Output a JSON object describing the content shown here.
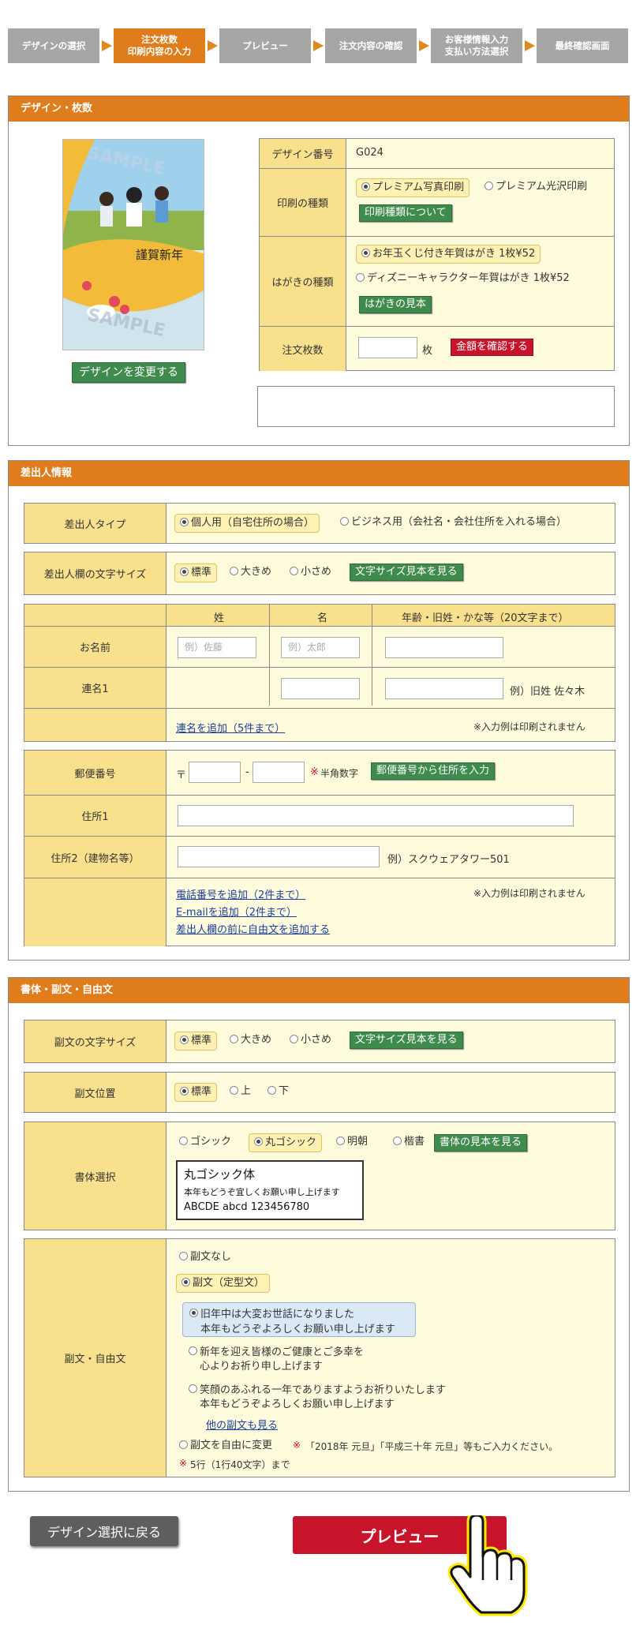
{
  "steps": [
    "デザインの選択",
    "注文枚数\n印刷内容の入力",
    "プレビュー",
    "注文内容の確認",
    "お客様情報入力\n支払い方法選択",
    "最終確認画面"
  ],
  "s1": {
    "title": "デザイン・枚数",
    "thumb_text": "謹賀新年",
    "watermark": "SAMPLE",
    "change_btn": "デザインを変更する",
    "design_label": "デザイン番号",
    "design_value": "G024",
    "print_label": "印刷の種類",
    "print_opt1": "プレミアム写真印刷",
    "print_opt2": "プレミアム光沢印刷",
    "print_btn": "印刷種類について",
    "card_label": "はがきの種類",
    "card_opt1": "お年玉くじ付き年賀はがき 1枚¥52",
    "card_opt2": "ディズニーキャラクター年賀はがき 1枚¥52",
    "card_btn": "はがきの見本",
    "qty_label": "注文枚数",
    "qty_unit": "枚",
    "qty_btn": "金額を確認する"
  },
  "s2": {
    "title": "差出人情報",
    "type_label": "差出人タイプ",
    "type_opt1": "個人用（自宅住所の場合）",
    "type_opt2": "ビジネス用（会社名・会社住所を入れる場合）",
    "size_label": "差出人欄の文字サイズ",
    "size_opt1": "標準",
    "size_opt2": "大きめ",
    "size_opt3": "小さめ",
    "size_btn": "文字サイズ見本を見る",
    "col_sei": "姓",
    "col_mei": "名",
    "col_extra": "年齢・旧姓・かな等（20文字まで）",
    "name_label": "お名前",
    "sei_ph": "例）佐藤",
    "mei_ph": "例）太郎",
    "renmei_label": "連名1",
    "renmei_hint": "例）旧姓 佐々木",
    "add_renmei": "連名を追加（5件まで）",
    "note1": "※入力例は印刷されません",
    "zip_label": "郵便番号",
    "zip_mark": "〒",
    "zip_dash": "-",
    "zip_note_mark": "※",
    "zip_note": "半角数字",
    "zip_btn": "郵便番号から住所を入力",
    "addr1_label": "住所1",
    "addr2_label": "住所2（建物名等）",
    "addr2_hint": "例）スクウェアタワー501",
    "add_tel": "電話番号を追加（2件まで）",
    "add_email": "E-mailを追加（2件まで）",
    "add_free": "差出人欄の前に自由文を追加する",
    "note2": "※入力例は印刷されません"
  },
  "s3": {
    "title": "書体・副文・自由文",
    "size_label": "副文の文字サイズ",
    "size_opt1": "標準",
    "size_opt2": "大きめ",
    "size_opt3": "小さめ",
    "size_btn": "文字サイズ見本を見る",
    "pos_label": "副文位置",
    "pos_opt1": "標準",
    "pos_opt2": "上",
    "pos_opt3": "下",
    "font_label": "書体選択",
    "font_opt1": "ゴシック",
    "font_opt2": "丸ゴシック",
    "font_opt3": "明朝",
    "font_opt4": "楷書",
    "font_btn": "書体の見本を見る",
    "sample_title": "丸ゴシック体",
    "sample_line1": "本年もどうぞ宜しくお願い申し上げます",
    "sample_line2": "ABCDE abcd 123456780",
    "fukubun_label": "副文・自由文",
    "fb_none": "副文なし",
    "fb_fixed": "副文（定型文）",
    "msg1a": "旧年中は大変お世話になりました",
    "msg1b": "本年もどうぞよろしくお願い申し上げます",
    "msg2a": "新年を迎え皆様のご健康とご多幸を",
    "msg2b": "心よりお祈り申し上げます",
    "msg3a": "笑顔のあふれる一年でありますようお祈りいたします",
    "msg3b": "本年もどうぞよろしくお願い申し上げます",
    "more_link": "他の副文も見る",
    "free_opt": "副文を自由に変更",
    "free_note_mark": "※",
    "free_note": "「2018年 元旦」「平成三十年 元旦」等もご入力ください。",
    "limit_mark": "※",
    "limit": "5行（1行40文字）まで"
  },
  "footer": {
    "back_btn": "デザイン選択に戻る",
    "preview_btn": "プレビュー"
  }
}
